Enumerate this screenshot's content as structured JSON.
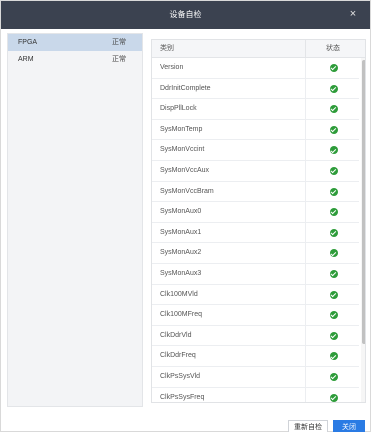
{
  "dialog": {
    "title": "设备自检",
    "close_icon": "×"
  },
  "modules": [
    {
      "name": "FPGA",
      "status": "正常",
      "active": true
    },
    {
      "name": "ARM",
      "status": "正常",
      "active": false
    }
  ],
  "table": {
    "col_category": "类别",
    "col_status": "状态",
    "rows": [
      {
        "name": "Version",
        "ok": true
      },
      {
        "name": "DdrInitComplete",
        "ok": true
      },
      {
        "name": "DispPllLock",
        "ok": true
      },
      {
        "name": "SysMonTemp",
        "ok": true
      },
      {
        "name": "SysMonVccint",
        "ok": true
      },
      {
        "name": "SysMonVccAux",
        "ok": true
      },
      {
        "name": "SysMonVccBram",
        "ok": true
      },
      {
        "name": "SysMonAux0",
        "ok": true
      },
      {
        "name": "SysMonAux1",
        "ok": true
      },
      {
        "name": "SysMonAux2",
        "ok": true
      },
      {
        "name": "SysMonAux3",
        "ok": true
      },
      {
        "name": "Clk100MVld",
        "ok": true
      },
      {
        "name": "Clk100MFreq",
        "ok": true
      },
      {
        "name": "ClkDdrVld",
        "ok": true
      },
      {
        "name": "ClkDdrFreq",
        "ok": true
      },
      {
        "name": "ClkPsSysVld",
        "ok": true
      },
      {
        "name": "ClkPsSysFreq",
        "ok": true
      }
    ]
  },
  "footer": {
    "recheck_label": "重新自检",
    "close_label": "关闭"
  },
  "colors": {
    "titlebar": "#3b4250",
    "accent": "#2a7be4",
    "ok": "#2e9c3a",
    "selected": "#c9d8ea"
  },
  "icons": {
    "ok_icon": "check-circle-icon",
    "close_icon": "close-icon"
  }
}
